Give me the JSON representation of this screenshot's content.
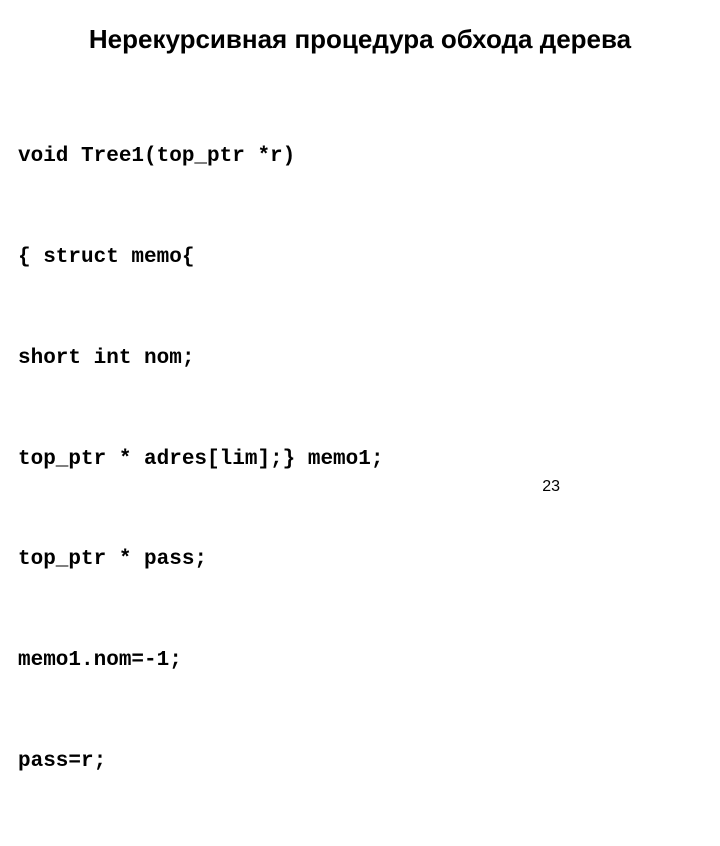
{
  "title": "Нерекурсивная процедура обхода дерева",
  "code": {
    "lines": [
      "void Tree1(top_ptr *r)",
      "{ struct memo{",
      "short int nom;",
      "top_ptr * adres[lim];} memo1;",
      "top_ptr * pass;",
      "memo1.nom=-1;",
      "pass=r;"
    ]
  },
  "page_number": "23"
}
